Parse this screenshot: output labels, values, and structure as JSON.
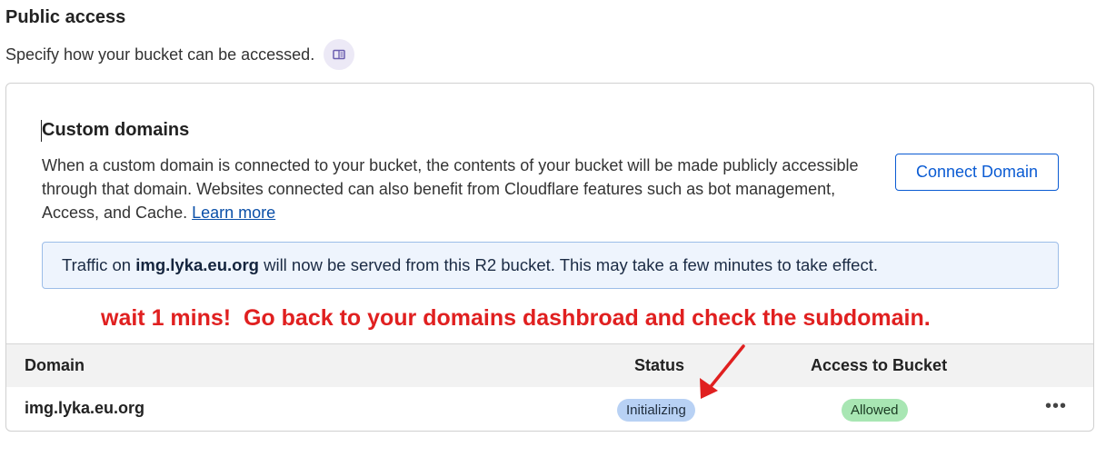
{
  "public_access": {
    "title": "Public access",
    "description": "Specify how your bucket can be accessed.",
    "doc_icon": "book-icon"
  },
  "custom_domains": {
    "title": "Custom domains",
    "description": "When a custom domain is connected to your bucket, the contents of your bucket will be made publicly accessible through that domain. Websites connected can also benefit from Cloudflare features such as bot management, Access, and Cache.",
    "learn_more": "Learn more",
    "connect_button": "Connect Domain"
  },
  "banner": {
    "prefix": "Traffic on ",
    "domain": "img.lyka.eu.org",
    "suffix": " will now be served from this R2 bucket. This may take a few minutes to take effect."
  },
  "annotation": {
    "text": "wait 1 mins!  Go back to your domains dashbroad and check the subdomain.",
    "color": "#e02020"
  },
  "table": {
    "headers": {
      "domain": "Domain",
      "status": "Status",
      "access": "Access to Bucket"
    },
    "rows": [
      {
        "domain": "img.lyka.eu.org",
        "status": "Initializing",
        "access": "Allowed",
        "menu": "•••"
      }
    ]
  },
  "colors": {
    "accent": "#0a5bd3",
    "status_badge": "#b8d1f4",
    "access_badge": "#a8e6b3",
    "banner_bg": "#eef4fd"
  }
}
